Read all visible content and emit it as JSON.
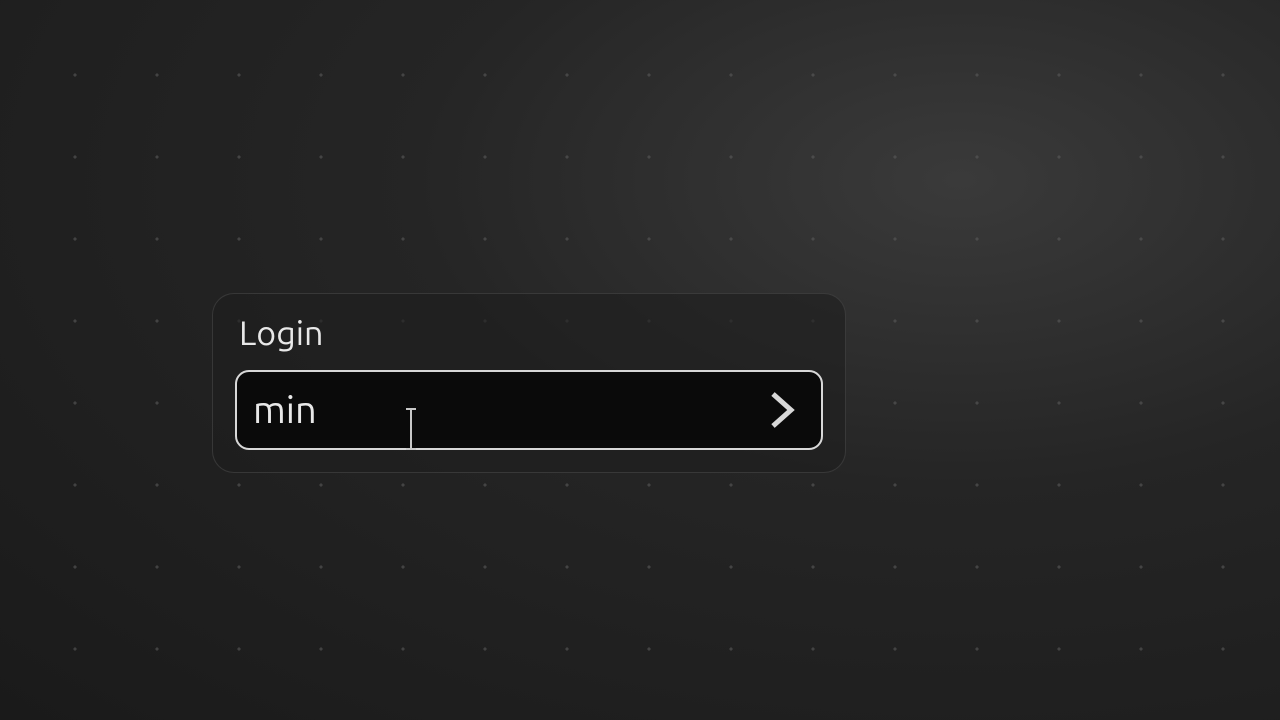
{
  "login": {
    "label": "Login",
    "input_value": "min",
    "input_placeholder": ""
  }
}
